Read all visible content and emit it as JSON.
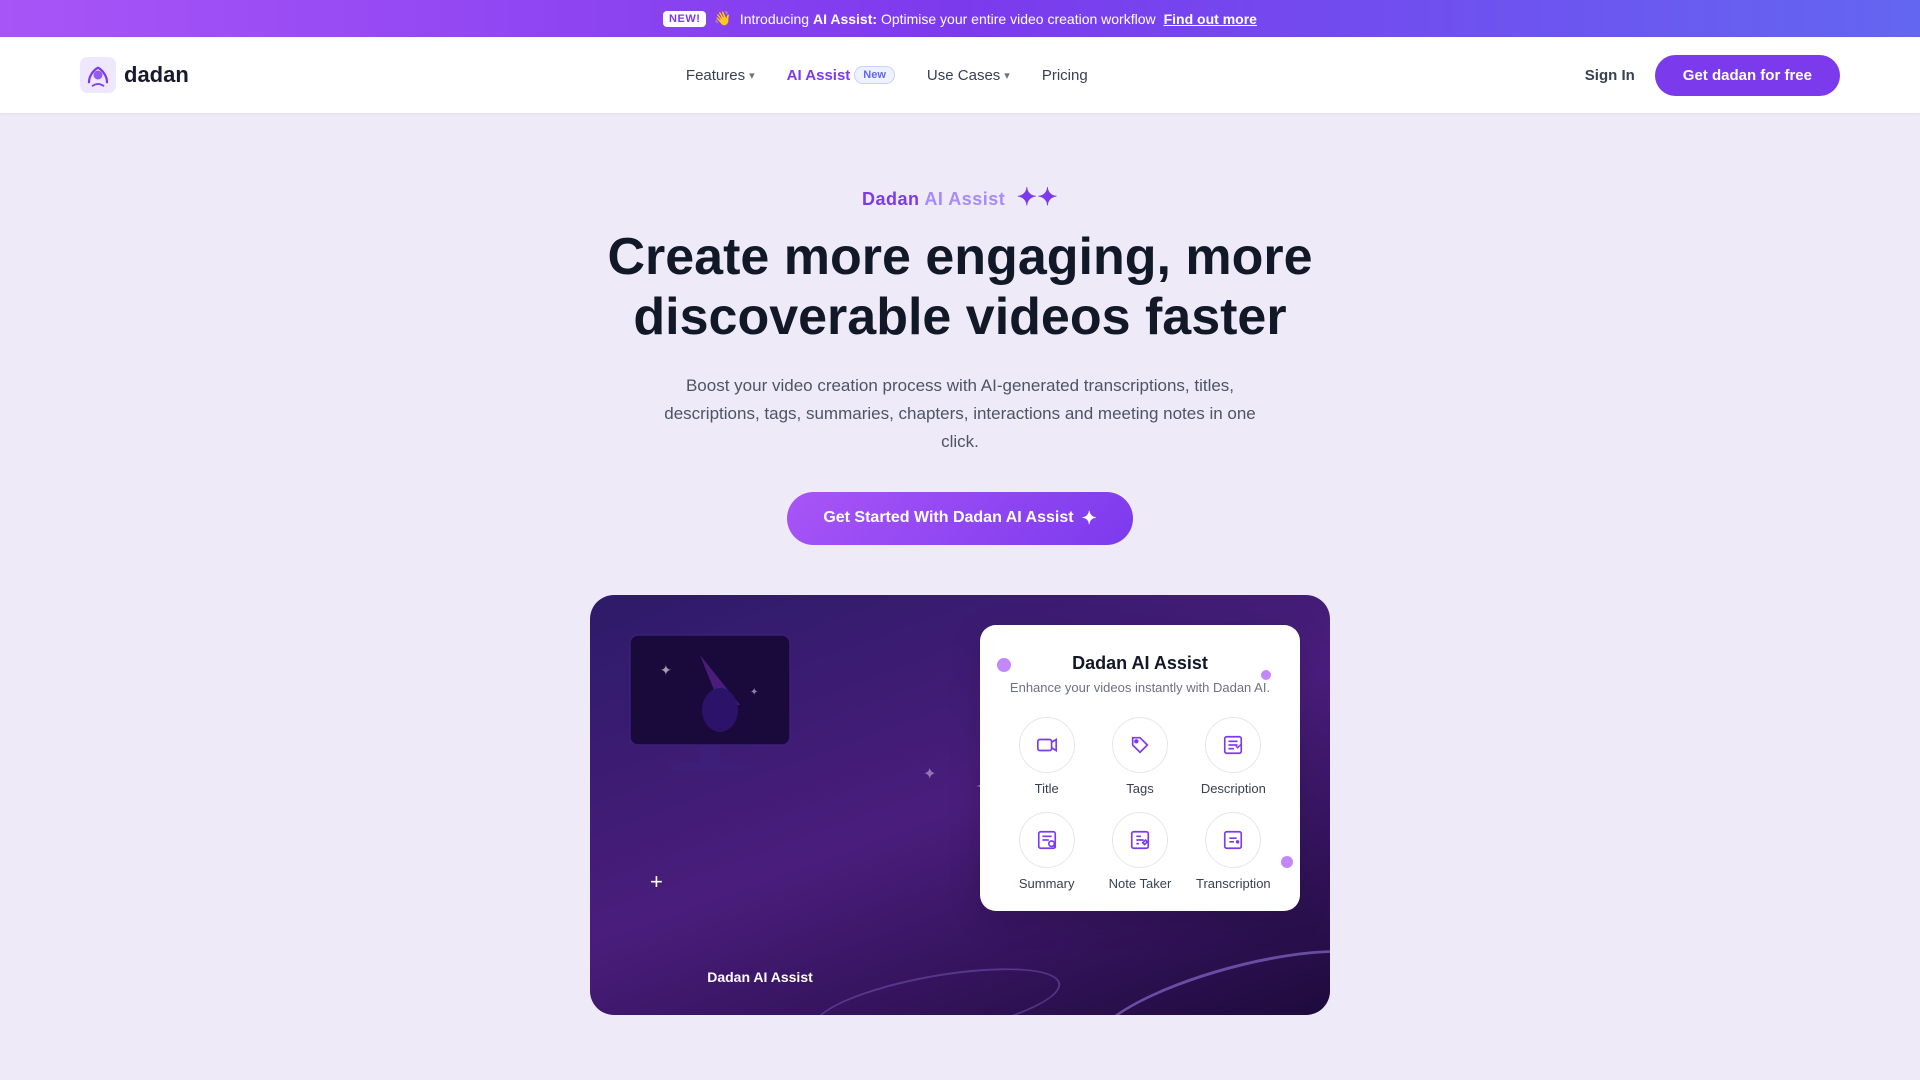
{
  "announcement": {
    "new_badge": "NEW!",
    "emoji": "👋",
    "text_before": "Introducing",
    "brand": "AI Assist:",
    "text_after": "Optimise your entire video creation workflow",
    "find_out_more": "Find out more"
  },
  "navbar": {
    "logo_text": "dadan",
    "nav_items": [
      {
        "label": "Features",
        "has_dropdown": true
      },
      {
        "label": "AI Assist",
        "is_highlight": true,
        "badge": "New"
      },
      {
        "label": "Use Cases",
        "has_dropdown": true
      },
      {
        "label": "Pricing",
        "has_dropdown": false
      }
    ],
    "sign_in": "Sign In",
    "cta": "Get dadan for free"
  },
  "hero": {
    "subtitle_dadan": "Dadan",
    "subtitle_ai": "AI Assist",
    "title": "Create more engaging, more discoverable videos faster",
    "description": "Boost your video creation process with AI-generated transcriptions, titles, descriptions, tags, summaries, chapters, interactions and meeting notes in one click.",
    "cta_label": "Get Started With Dadan AI Assist"
  },
  "ai_card": {
    "title": "Dadan AI Assist",
    "description": "Enhance your videos instantly with Dadan AI.",
    "features": [
      {
        "label": "Title",
        "icon": "🎬"
      },
      {
        "label": "Tags",
        "icon": "🏷️"
      },
      {
        "label": "Description",
        "icon": "📋"
      },
      {
        "label": "Summary",
        "icon": "📄"
      },
      {
        "label": "Note Taker",
        "icon": "✏️"
      },
      {
        "label": "Transcription",
        "icon": "🎙️"
      }
    ]
  },
  "wizard_label": "Dadan AI Assist"
}
